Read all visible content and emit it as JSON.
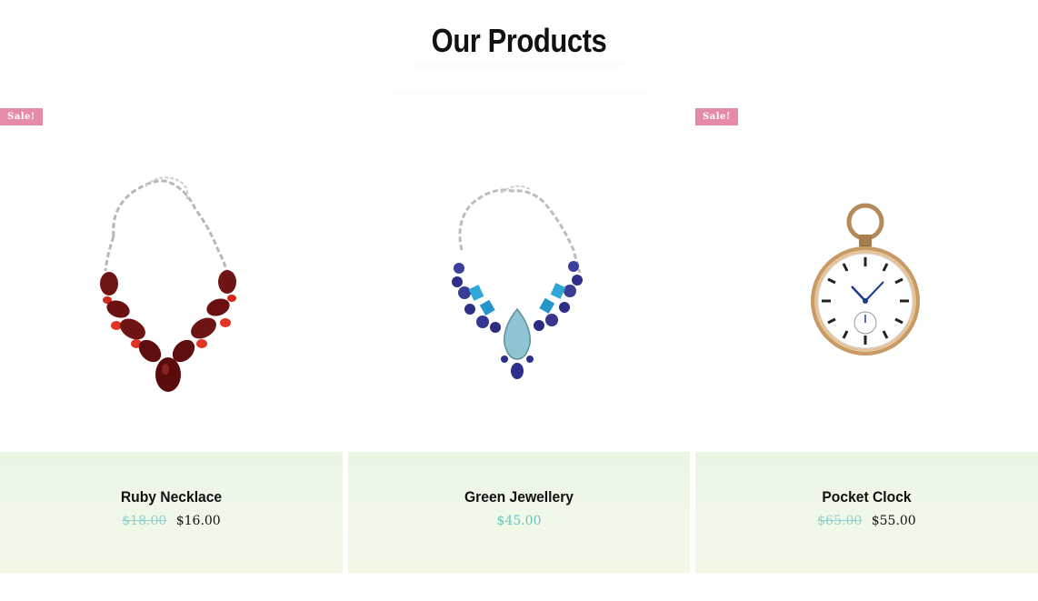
{
  "section": {
    "title": "Our Products"
  },
  "products": [
    {
      "name": "Ruby Necklace",
      "badge": "Sale!",
      "old_price": "$18.00",
      "price": "$16.00"
    },
    {
      "name": "Green Jewellery",
      "price": "$45.00"
    },
    {
      "name": "Pocket Clock",
      "badge": "Sale!",
      "old_price": "$65.00",
      "price": "$55.00"
    }
  ],
  "colors": {
    "badge": "#e58aa9",
    "info_background": "#eef7e7",
    "old_price": "#8fd0cb",
    "regular_price": "#6cc3bc"
  }
}
